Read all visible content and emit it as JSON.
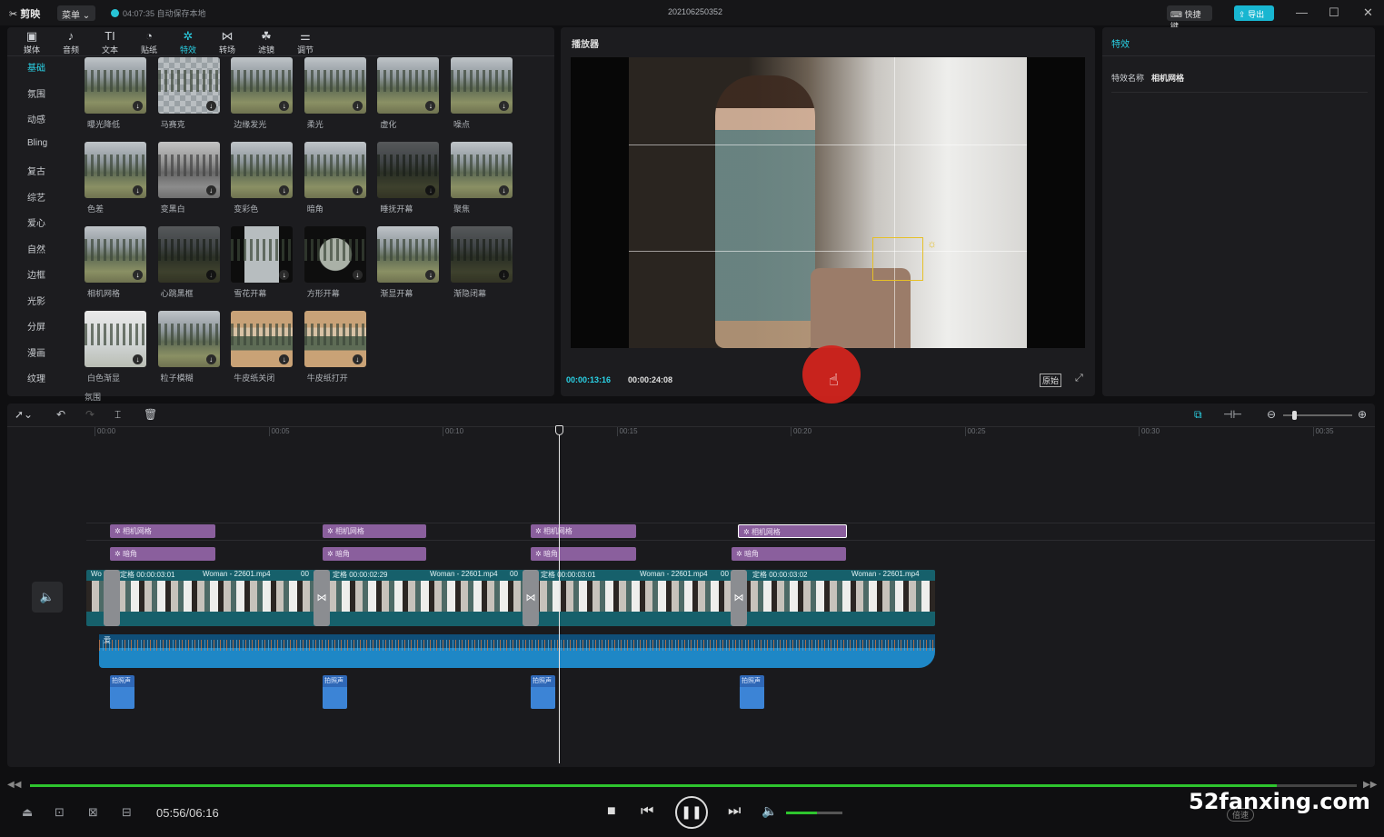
{
  "titlebar": {
    "app_name": "剪映",
    "menu_label": "菜单",
    "autosave": "04:07:35 自动保存本地",
    "project_title": "202106250352",
    "shortcut_label": "快捷键",
    "export_label": "导出"
  },
  "toolbar": {
    "tools": [
      {
        "icon": "▣",
        "label": "媒体"
      },
      {
        "icon": "♪",
        "label": "音频"
      },
      {
        "icon": "TI",
        "label": "文本"
      },
      {
        "icon": "◔",
        "label": "贴纸"
      },
      {
        "icon": "✲",
        "label": "特效"
      },
      {
        "icon": "⋈",
        "label": "转场"
      },
      {
        "icon": "☘",
        "label": "滤镜"
      },
      {
        "icon": "⚌",
        "label": "调节"
      }
    ]
  },
  "categories": [
    "基础",
    "氛围",
    "动感",
    "Bling",
    "复古",
    "综艺",
    "爱心",
    "自然",
    "边框",
    "光影",
    "分屏",
    "漫画",
    "纹理"
  ],
  "effects": {
    "row1": [
      "曝光降低",
      "马赛克",
      "边缘发光",
      "柔光",
      "虚化",
      "噪点"
    ],
    "row2": [
      "色差",
      "变黑白",
      "变彩色",
      "暗角",
      "睡抚开幕",
      "聚焦"
    ],
    "row3": [
      "相机网格",
      "心跳黑框",
      "雪花开幕",
      "方形开幕",
      "渐显开幕",
      "渐隐闭幕"
    ],
    "row4": [
      "白色渐显",
      "粒子模糊",
      "牛皮纸关闭",
      "牛皮纸打开"
    ],
    "more_label": "氛围"
  },
  "player": {
    "title": "播放器",
    "current_time": "00:00:13:16",
    "duration": "00:00:24:08",
    "ratio_label": "原始"
  },
  "properties": {
    "title": "特效",
    "name_label": "特效名称",
    "name_value": "相机网格"
  },
  "timeline": {
    "ruler_ticks": [
      "00:00",
      "00:05",
      "00:10",
      "00:15",
      "00:20",
      "00:25",
      "00:30",
      "00:35"
    ],
    "fx_track1": "相机网格",
    "fx_track2": "暗角",
    "video_clips": [
      {
        "label": "Wo"
      },
      {
        "label": "定格  00:00:03:01"
      },
      {
        "label": "Woman - 22601.mp4"
      },
      {
        "label": "00"
      },
      {
        "label": "定格  00:00:02:29"
      },
      {
        "label": "Woman - 22601.mp4"
      },
      {
        "label": "00"
      },
      {
        "label": "定格  00:00:03:01"
      },
      {
        "label": "Woman - 22601.mp4"
      },
      {
        "label": "00"
      },
      {
        "label": "定格  00:00:03:02"
      },
      {
        "label": "Woman - 22601.mp4"
      }
    ],
    "audio_label": "爱",
    "sfx_label": "拍照声"
  },
  "bottombar": {
    "time": "05:56/06:16",
    "speed_label": "倍速",
    "progress_fraction": 0.94,
    "volume_fraction": 0.55
  },
  "watermark": "52fanxing.com",
  "colors": {
    "accent": "#2ad2e6",
    "fx_clip": "#8a5f9d",
    "video_track": "#16606b",
    "audio_track": "#1e87c6",
    "export_button": "#18b6d1"
  }
}
